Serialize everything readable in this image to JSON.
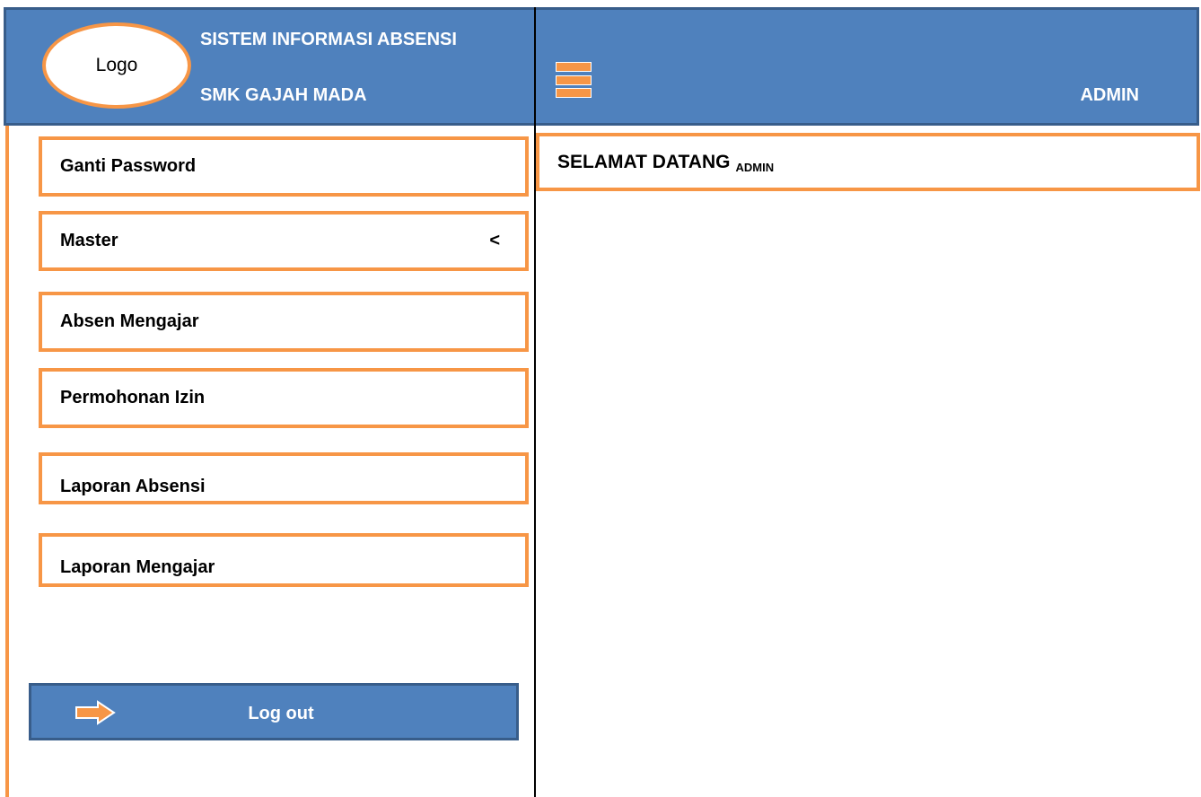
{
  "header": {
    "logo_text": "Logo",
    "app_title": "SISTEM INFORMASI ABSENSI",
    "school_name": "SMK GAJAH MADA",
    "user_label": "ADMIN"
  },
  "sidebar": {
    "items": [
      {
        "label": "Ganti Password"
      },
      {
        "label": "Master",
        "chevron": "<"
      },
      {
        "label": "Absen Mengajar"
      },
      {
        "label": "Permohonan Izin"
      },
      {
        "label": "Laporan Absensi"
      },
      {
        "label": "Laporan Mengajar"
      }
    ],
    "logout_label": "Log out"
  },
  "main": {
    "welcome_text": "SELAMAT DATANG",
    "welcome_user": "ADMIN"
  },
  "colors": {
    "header_bg": "#4f81bd",
    "header_border": "#385d8a",
    "accent": "#f79646",
    "text_light": "#ffffff"
  },
  "icons": {
    "menu": "hamburger-icon",
    "logout": "right-arrow-icon"
  }
}
